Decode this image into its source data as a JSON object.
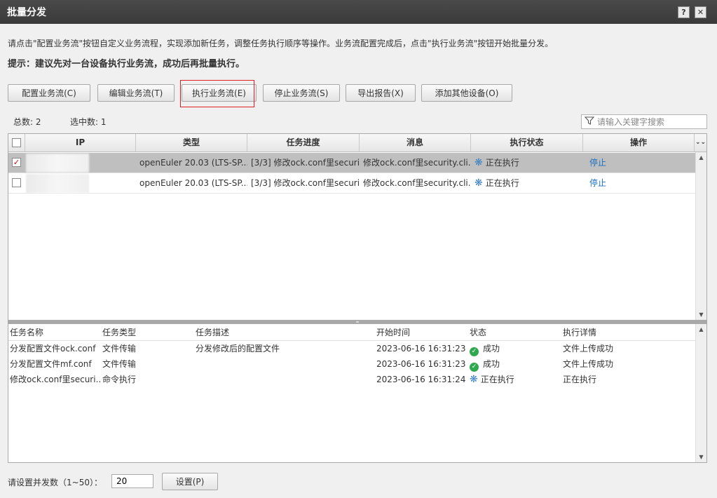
{
  "window": {
    "title": "批量分发",
    "help_label": "?",
    "close_label": "✕"
  },
  "hint": {
    "line1": "请点击\"配置业务流\"按钮自定义业务流程，实现添加新任务，调整任务执行顺序等操作。业务流配置完成后，点击\"执行业务流\"按钮开始批量分发。",
    "line2": "提示：建议先对一台设备执行业务流，成功后再批量执行。"
  },
  "toolbar": {
    "configure": "配置业务流(C)",
    "edit": "编辑业务流(T)",
    "execute": "执行业务流(E)",
    "stop": "停止业务流(S)",
    "export": "导出报告(X)",
    "add_device": "添加其他设备(O)"
  },
  "summary": {
    "total_label": "总数:",
    "total": "2",
    "selected_label": "选中数:",
    "selected": "1"
  },
  "search": {
    "placeholder": "请输入关键字搜索"
  },
  "device_table": {
    "columns": {
      "ip": "IP",
      "type": "类型",
      "progress": "任务进度",
      "message": "消息",
      "status": "执行状态",
      "action": "操作"
    },
    "rows": [
      {
        "checked": "✓",
        "ip": "",
        "type": "openEuler 20.03 (LTS-SP...",
        "progress": "[3/3] 修改ock.conf里securi...",
        "message": "修改ock.conf里security.cli...",
        "status": "正在执行",
        "action": "停止"
      },
      {
        "checked": "",
        "ip": "",
        "type": "openEuler 20.03 (LTS-SP...",
        "progress": "[3/3] 修改ock.conf里securi...",
        "message": "修改ock.conf里security.cli...",
        "status": "正在执行",
        "action": "停止"
      }
    ]
  },
  "task_table": {
    "columns": {
      "name": "任务名称",
      "type": "任务类型",
      "desc": "任务描述",
      "start": "开始时间",
      "status": "状态",
      "detail": "执行详情"
    },
    "rows": [
      {
        "name": "分发配置文件ock.conf",
        "type": "文件传输",
        "desc": "分发修改后的配置文件",
        "start": "2023-06-16 16:31:23",
        "status": "成功",
        "detail": "文件上传成功"
      },
      {
        "name": "分发配置文件mf.conf",
        "type": "文件传输",
        "desc": "",
        "start": "2023-06-16 16:31:23",
        "status": "成功",
        "detail": "文件上传成功"
      },
      {
        "name": "修改ock.conf里securi...",
        "type": "命令执行",
        "desc": "",
        "start": "2023-06-16 16:31:24",
        "status": "正在执行",
        "detail": "正在执行"
      }
    ]
  },
  "concurrency": {
    "label": "请设置并发数（1~50）：",
    "value": "20",
    "set_button": "设置(P)"
  },
  "colors": {
    "accent_red": "#e02020",
    "link": "#1e6fc0",
    "success": "#2fa84f",
    "running": "#3b82c4"
  }
}
